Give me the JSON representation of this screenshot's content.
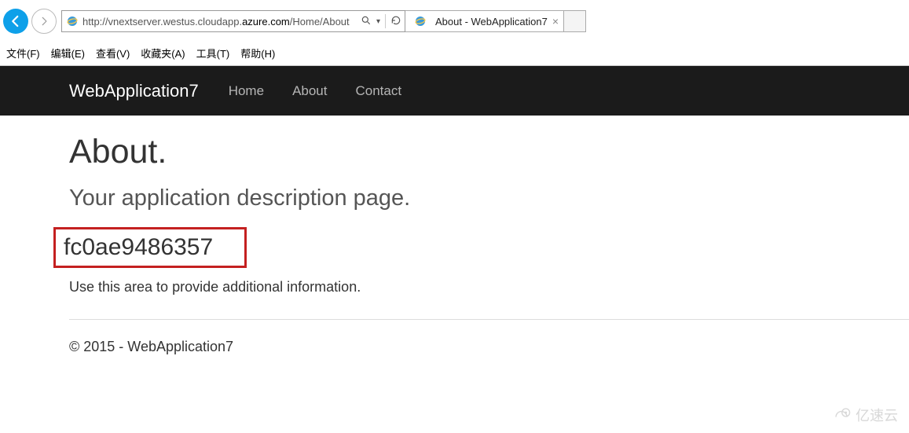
{
  "browser": {
    "url_pre": "http://vnextserver.westus.cloudapp.",
    "url_domain": "azure.com",
    "url_post": "/Home/About",
    "tab_title": "About - WebApplication7"
  },
  "menu": {
    "file": "文件(F)",
    "edit": "编辑(E)",
    "view": "查看(V)",
    "favorites": "收藏夹(A)",
    "tools": "工具(T)",
    "help": "帮助(H)"
  },
  "navbar": {
    "brand": "WebApplication7",
    "home": "Home",
    "about": "About",
    "contact": "Contact"
  },
  "page": {
    "title": "About.",
    "subtitle": "Your application description page.",
    "highlighted": "fc0ae9486357",
    "description": "Use this area to provide additional information.",
    "footer": "© 2015 - WebApplication7"
  },
  "watermark": "亿速云"
}
